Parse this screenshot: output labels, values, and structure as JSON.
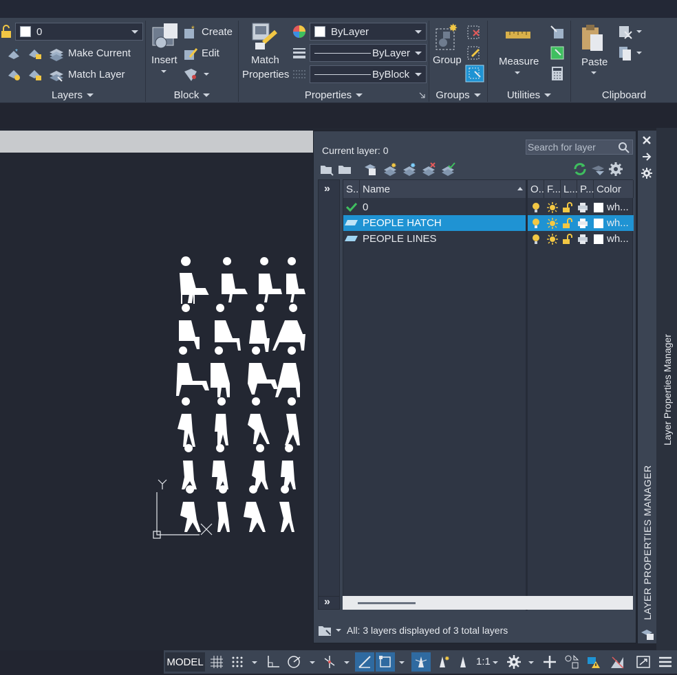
{
  "ribbon": {
    "layers": {
      "current_layer_value": "0",
      "make_current_label": "Make Current",
      "match_layer_label": "Match Layer",
      "panel_title": "Layers"
    },
    "block": {
      "insert_label": "Insert",
      "create_label": "Create",
      "edit_label": "Edit",
      "panel_title": "Block"
    },
    "properties": {
      "match_label_line1": "Match",
      "match_label_line2": "Properties",
      "color_value": "ByLayer",
      "linetype_value": "ByLayer",
      "lineweight_value": "ByBlock",
      "panel_title": "Properties"
    },
    "groups": {
      "group_label": "Group",
      "panel_title": "Groups"
    },
    "utilities": {
      "measure_label": "Measure",
      "panel_title": "Utilities"
    },
    "clipboard": {
      "paste_label": "Paste",
      "panel_title": "Clipboard"
    }
  },
  "layer_manager": {
    "current_layer_label": "Current layer: 0",
    "search_placeholder": "Search for layer",
    "columns": {
      "status": "S..",
      "name": "Name",
      "on": "O..",
      "freeze": "F...",
      "lock": "L...",
      "plot": "P...",
      "color": "Color"
    },
    "layers": [
      {
        "name": "0",
        "color": "wh...",
        "current": true,
        "selected": false
      },
      {
        "name": "PEOPLE HATCH",
        "color": "wh...",
        "current": false,
        "selected": true
      },
      {
        "name": "PEOPLE LINES",
        "color": "wh...",
        "current": false,
        "selected": false
      }
    ],
    "status_text": "All: 3 layers displayed of 3 total layers",
    "palette_title": "LAYER PROPERTIES MANAGER",
    "side_tab": "Layer Properties Manager"
  },
  "canvas": {
    "ucs_y_label": "Y",
    "ucs_x_label": "X"
  },
  "statusbar": {
    "model_label": "MODEL",
    "scale_label": "1:1"
  },
  "colors": {
    "ribbon_bg": "#3b4453",
    "canvas_bg": "#232732",
    "selection": "#1f93d3",
    "bulb": "#f2c744",
    "check": "#3fbf5f"
  }
}
